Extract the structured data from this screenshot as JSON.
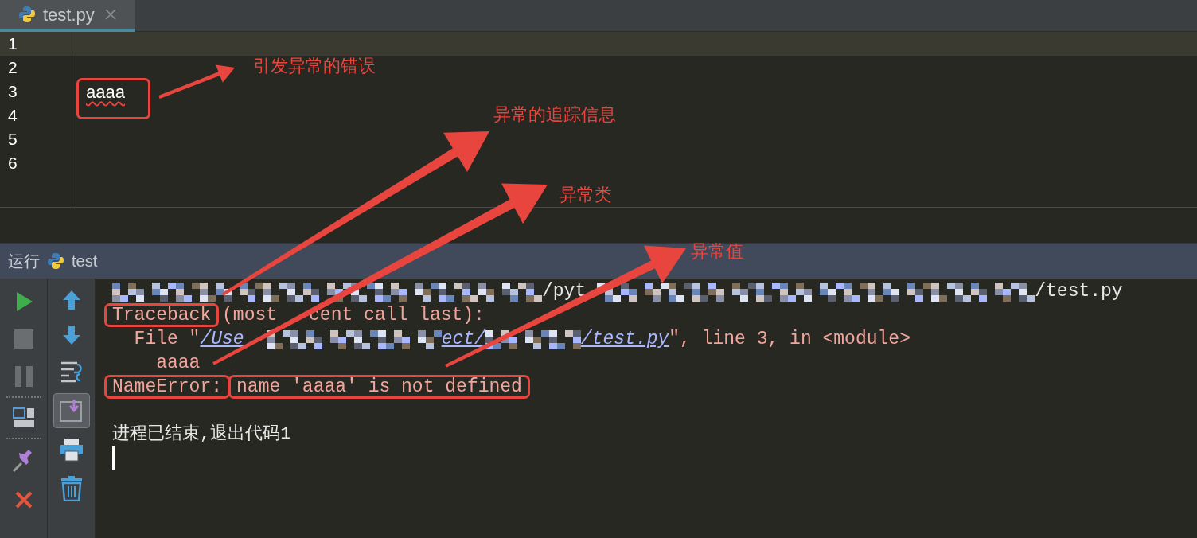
{
  "tabs": [
    {
      "label": "test.py",
      "selected": true,
      "closable": true
    }
  ],
  "editor": {
    "lines": [
      {
        "number": "1",
        "current": true
      },
      {
        "number": "2",
        "current": false
      },
      {
        "number": "3",
        "text": "aaaa",
        "current": false,
        "error": true
      },
      {
        "number": "4",
        "current": false
      },
      {
        "number": "5",
        "current": false
      },
      {
        "number": "6",
        "current": false
      }
    ]
  },
  "run_panel": {
    "title": "运行",
    "config": "test"
  },
  "toolbar_primary": [
    {
      "kind": "run",
      "disabled": false
    },
    {
      "kind": "stop",
      "disabled": true
    },
    {
      "kind": "pause",
      "disabled": true
    },
    {
      "kind": "separator"
    },
    {
      "kind": "layout",
      "disabled": false
    },
    {
      "kind": "separator"
    },
    {
      "kind": "pin",
      "disabled": false
    },
    {
      "kind": "close",
      "disabled": false
    }
  ],
  "toolbar_secondary": [
    {
      "kind": "up",
      "on": false
    },
    {
      "kind": "down",
      "on": false
    },
    {
      "kind": "wrap",
      "on": false
    },
    {
      "kind": "scroll",
      "on": true
    },
    {
      "kind": "print",
      "on": false
    },
    {
      "kind": "trash",
      "on": false
    }
  ],
  "console": {
    "lines": [
      [
        {
          "kind": "redacted"
        },
        {
          "kind": "stdout",
          "text": "/pyt",
          "framed": false
        },
        {
          "kind": "covered"
        },
        {
          "kind": "redacted"
        },
        {
          "kind": "stdout",
          "text": "/test.py",
          "framed": false
        }
      ],
      [
        {
          "kind": "stderr",
          "text": "Traceback",
          "framed": true
        },
        {
          "kind": "stderr",
          "text": " (most",
          "framed": false
        },
        {
          "kind": "covered"
        },
        {
          "kind": "stderr",
          "text": "cent call last):",
          "framed": false
        }
      ],
      [
        {
          "kind": "stderr",
          "text": "  File \"",
          "framed": false
        },
        {
          "kind": "link",
          "text": "/Use",
          "framed": false
        },
        {
          "kind": "covered"
        },
        {
          "kind": "redacted"
        },
        {
          "kind": "link",
          "text": "ect/",
          "framed": false
        },
        {
          "kind": "redacted"
        },
        {
          "kind": "link",
          "text": "/test.py",
          "framed": false
        },
        {
          "kind": "stderr",
          "text": "\", line 3, in <module>",
          "framed": false
        }
      ],
      [
        {
          "kind": "stderr",
          "text": "    aaaa",
          "framed": false
        }
      ],
      [
        {
          "kind": "stderr",
          "text": "NameError:",
          "framed": true
        },
        {
          "kind": "stderr",
          "text": "name 'aaaa' is not defined",
          "framed": true
        }
      ]
    ],
    "exit_message": "进程已结束,退出代码1",
    "caret": true
  },
  "annotations": [
    "引发异常的错误",
    "异常的追踪信息",
    "异常类",
    "异常值"
  ]
}
